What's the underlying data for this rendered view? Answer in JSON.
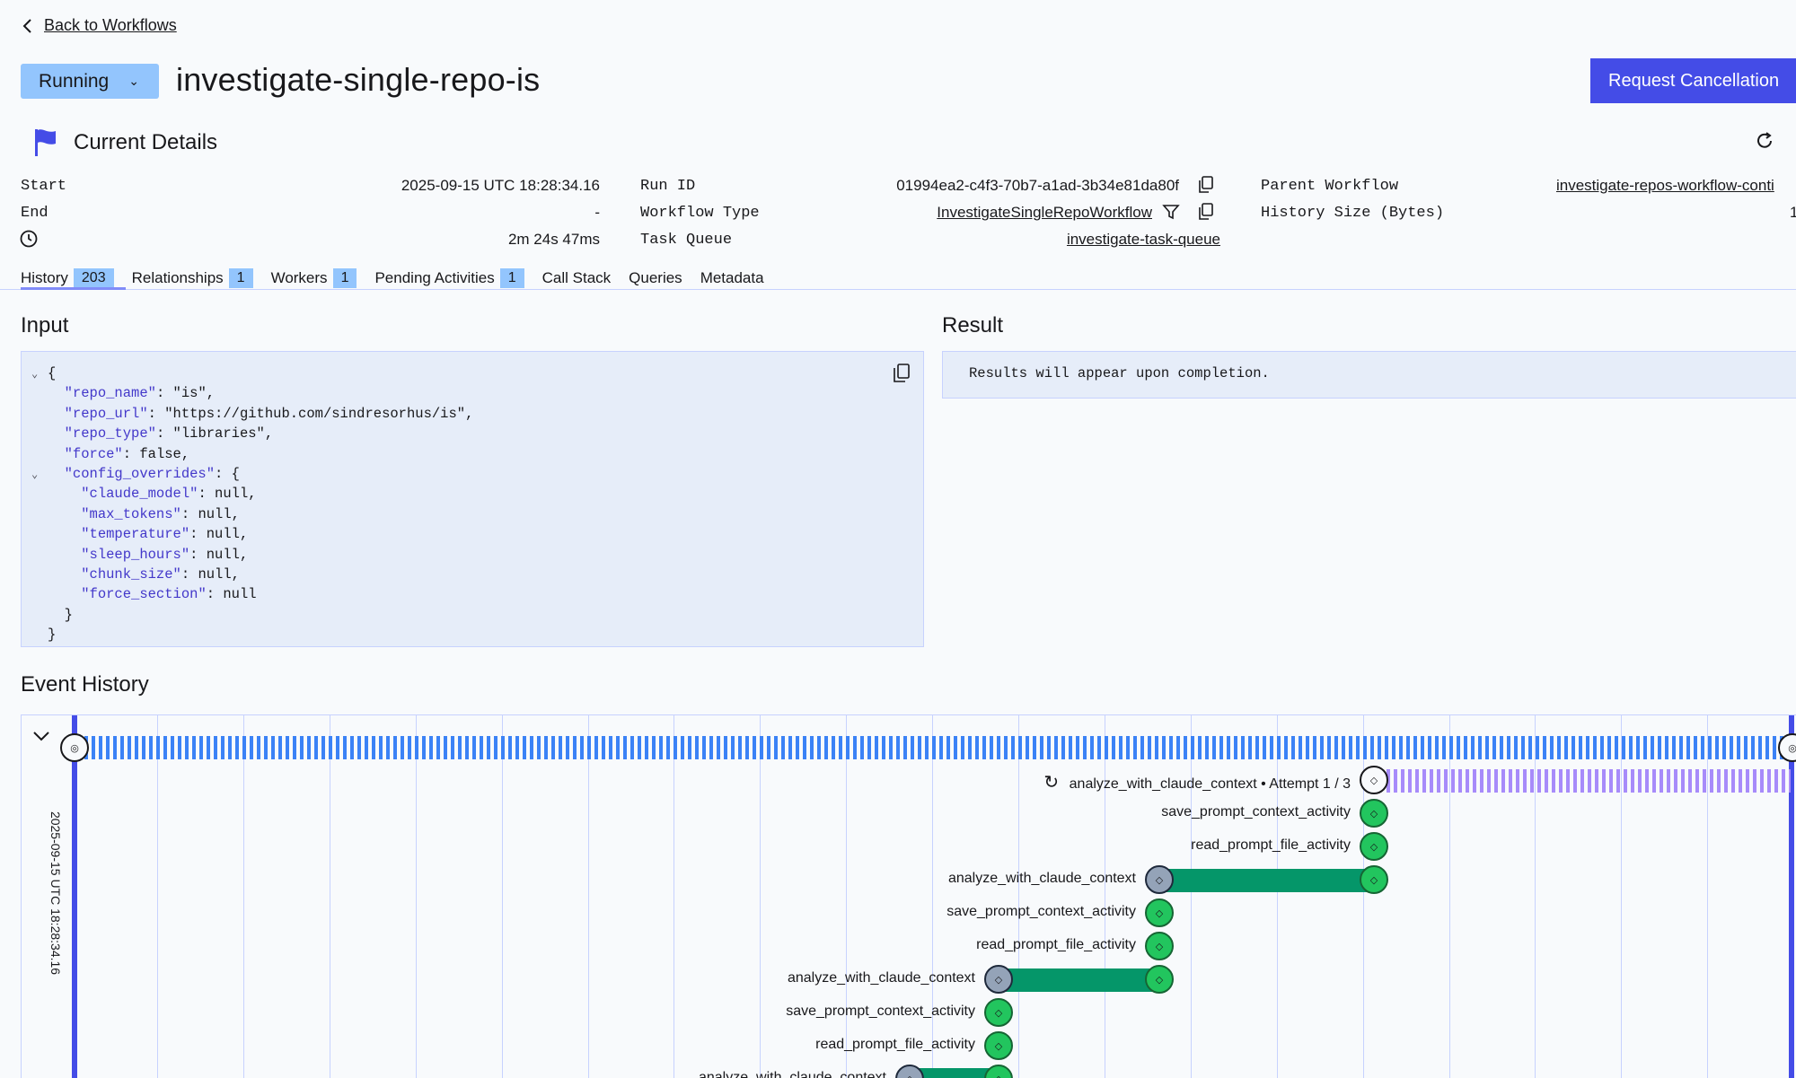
{
  "nav": {
    "back_label": "Back to Workflows"
  },
  "header": {
    "status": "Running",
    "workflow_id": "investigate-single-repo-is",
    "cancel_label": "Request Cancellation"
  },
  "details": {
    "title": "Current Details",
    "start_label": "Start",
    "start_value": "2025-09-15 UTC 18:28:34.16",
    "end_label": "End",
    "end_value": "-",
    "duration_value": "2m 24s 47ms",
    "run_id_label": "Run ID",
    "run_id_value": "01994ea2-c4f3-70b7-a1ad-3b34e81da80f",
    "workflow_type_label": "Workflow Type",
    "workflow_type_value": "InvestigateSingleRepoWorkflow",
    "task_queue_label": "Task Queue",
    "task_queue_value": "investigate-task-queue",
    "parent_label": "Parent Workflow",
    "parent_value": "investigate-repos-workflow-conti",
    "history_size_label": "History Size (Bytes)",
    "history_size_value": "1"
  },
  "tabs": [
    {
      "label": "History",
      "badge": "203"
    },
    {
      "label": "Relationships",
      "badge": "1"
    },
    {
      "label": "Workers",
      "badge": "1"
    },
    {
      "label": "Pending Activities",
      "badge": "1"
    },
    {
      "label": "Call Stack",
      "badge": ""
    },
    {
      "label": "Queries",
      "badge": ""
    },
    {
      "label": "Metadata",
      "badge": ""
    }
  ],
  "input": {
    "title": "Input",
    "lines": [
      {
        "indent": 0,
        "caret": true,
        "key": "",
        "rest": "{"
      },
      {
        "indent": 1,
        "caret": false,
        "key": "\"repo_name\"",
        "rest": ": \"is\","
      },
      {
        "indent": 1,
        "caret": false,
        "key": "\"repo_url\"",
        "rest": ": \"https://github.com/sindresorhus/is\","
      },
      {
        "indent": 1,
        "caret": false,
        "key": "\"repo_type\"",
        "rest": ": \"libraries\","
      },
      {
        "indent": 1,
        "caret": false,
        "key": "\"force\"",
        "rest": ": false,"
      },
      {
        "indent": 1,
        "caret": true,
        "key": "\"config_overrides\"",
        "rest": ": {"
      },
      {
        "indent": 2,
        "caret": false,
        "key": "\"claude_model\"",
        "rest": ": null,"
      },
      {
        "indent": 2,
        "caret": false,
        "key": "\"max_tokens\"",
        "rest": ": null,"
      },
      {
        "indent": 2,
        "caret": false,
        "key": "\"temperature\"",
        "rest": ": null,"
      },
      {
        "indent": 2,
        "caret": false,
        "key": "\"sleep_hours\"",
        "rest": ": null,"
      },
      {
        "indent": 2,
        "caret": false,
        "key": "\"chunk_size\"",
        "rest": ": null,"
      },
      {
        "indent": 2,
        "caret": false,
        "key": "\"force_section\"",
        "rest": ": null"
      },
      {
        "indent": 1,
        "caret": false,
        "key": "",
        "rest": "}"
      },
      {
        "indent": 0,
        "caret": false,
        "key": "",
        "rest": "}"
      }
    ]
  },
  "result": {
    "title": "Result",
    "text": "Results will appear upon completion."
  },
  "event_history": {
    "title": "Event History",
    "date_label": "2025-09-15 UTC 18:28:34.16",
    "rows": [
      {
        "label": "analyze_with_claude_context • Attempt 1 / 3",
        "kind": "pending",
        "retry": true
      },
      {
        "label": "save_prompt_context_activity",
        "kind": "done"
      },
      {
        "label": "read_prompt_file_activity",
        "kind": "done"
      },
      {
        "label": "analyze_with_claude_context",
        "kind": "span"
      },
      {
        "label": "save_prompt_context_activity",
        "kind": "done"
      },
      {
        "label": "read_prompt_file_activity",
        "kind": "done"
      },
      {
        "label": "analyze_with_claude_context",
        "kind": "span"
      },
      {
        "label": "save_prompt_context_activity",
        "kind": "done"
      },
      {
        "label": "read_prompt_file_activity",
        "kind": "done"
      },
      {
        "label": "analyze_with_claude_context",
        "kind": "span"
      }
    ]
  }
}
